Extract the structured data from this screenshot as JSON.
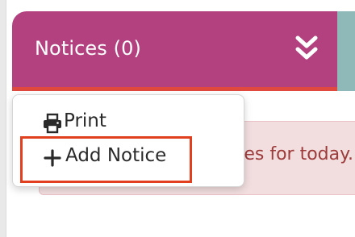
{
  "header": {
    "title": "Notices (0)",
    "collapse_icon": "double-chevron-down-icon",
    "color": "#b3417f",
    "accent_underline": "#e0493d"
  },
  "alert": {
    "visible_text": "es for today."
  },
  "dropdown": {
    "items": [
      {
        "label": "Print",
        "icon": "printer-icon"
      },
      {
        "label": "Add Notice",
        "icon": "plus-icon"
      }
    ],
    "highlighted_item": "Add Notice",
    "highlight_color": "#e23f1e"
  }
}
